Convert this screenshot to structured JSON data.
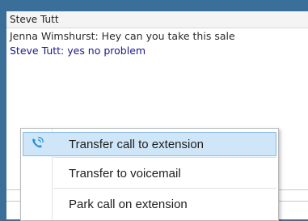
{
  "window": {
    "title": "Steve Tutt"
  },
  "chat": {
    "messages": [
      {
        "text": "Jenna Wimshurst: Hey can you take this sale"
      },
      {
        "text": "Steve Tutt: yes no problem"
      }
    ]
  },
  "context_menu": {
    "items": [
      {
        "label": "Transfer call to extension",
        "icon": "phone-transfer-icon",
        "selected": true
      },
      {
        "label": "Transfer to voicemail",
        "selected": false
      },
      {
        "label": "Park call on extension",
        "selected": false
      }
    ]
  },
  "colors": {
    "frame": "#3a6f9a",
    "selection": "#cfe6f8",
    "selection_border": "#86b9e3",
    "own_message": "#1a1a8a",
    "icon": "#2b8fd6"
  }
}
